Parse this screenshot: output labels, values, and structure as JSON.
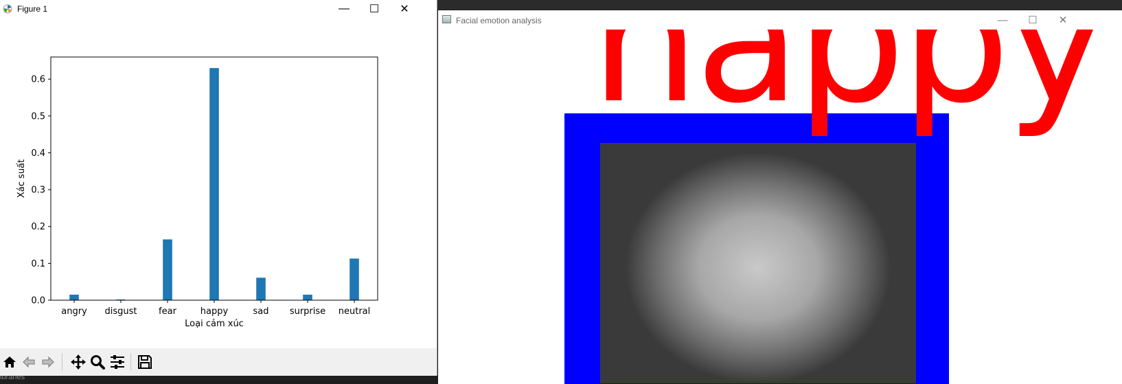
{
  "figure_window": {
    "title": "Figure 1",
    "controls": {
      "minimize": "—",
      "maximize": "☐",
      "close": "✕"
    },
    "toolbar": [
      "home-icon",
      "back-arrow-icon",
      "forward-arrow-icon",
      "pan-icon",
      "zoom-icon",
      "configure-subplots-icon",
      "save-icon"
    ]
  },
  "chart_data": {
    "type": "bar",
    "categories": [
      "angry",
      "disgust",
      "fear",
      "happy",
      "sad",
      "surprise",
      "neutral"
    ],
    "values": [
      0.015,
      0.002,
      0.165,
      0.63,
      0.061,
      0.015,
      0.113
    ],
    "xlabel": "Loại cảm xúc",
    "ylabel": "Xác suất",
    "ylim": [
      0,
      0.66
    ],
    "yticks": [
      "0.0",
      "0.1",
      "0.2",
      "0.3",
      "0.4",
      "0.5",
      "0.6"
    ],
    "bar_color": "#1f77b4",
    "grid": false
  },
  "emotion_window": {
    "title": "Facial emotion analysis",
    "controls": {
      "minimize": "—",
      "maximize": "☐",
      "close": "✕"
    },
    "label": "happy",
    "label_color": "#ff0000",
    "box_color": "#0000ff"
  },
  "taskbar_fragment": "ibraries"
}
